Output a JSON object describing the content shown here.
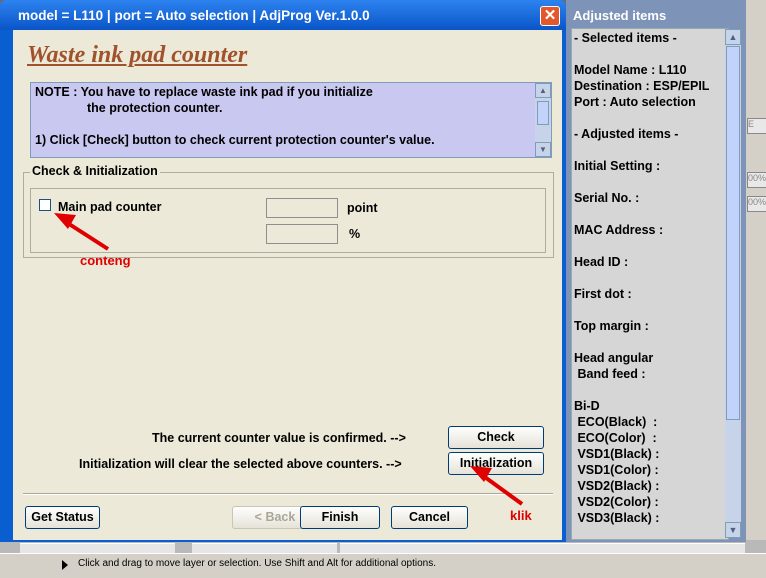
{
  "window": {
    "title": "model = L110  |  port = Auto selection  |  AdjProg Ver.1.0.0",
    "close_glyph": "✕"
  },
  "heading": "Waste ink pad counter",
  "note": {
    "line1": "NOTE : You have to replace waste ink pad if you initialize",
    "line2": "the protection counter.",
    "line3": "1) Click [Check] button to check current protection counter's value."
  },
  "check_group": {
    "label": "Check & Initialization",
    "main_pad_label": "Main pad counter",
    "main_pad_checked": false,
    "point_value": "",
    "point_unit": "point",
    "percent_value": "",
    "percent_unit": "%"
  },
  "annotations": {
    "conteng": "conteng",
    "klik": "klik",
    "color": "#e00000"
  },
  "actions": {
    "confirm_text": "The current counter value is confirmed. -->",
    "check_label": "Check",
    "init_text": "Initialization will clear the selected above counters. -->",
    "init_label": "Initialization"
  },
  "footer": {
    "get_status": "Get Status",
    "back": "< Back",
    "finish": "Finish",
    "cancel": "Cancel"
  },
  "adjusted_panel": {
    "title": "Adjusted items",
    "lines": [
      "- Selected items -",
      "Model Name : L110",
      "Destination : ESP/EPIL",
      "Port : Auto selection",
      "- Adjusted items -",
      "Initial Setting :",
      "Serial No. :",
      "MAC Address :",
      "Head ID :",
      "First dot :",
      "Top margin :",
      "Head angular",
      " Band feed :",
      "Bi-D",
      " ECO(Black)  :",
      " ECO(Color)  :",
      " VSD1(Black) :",
      " VSD1(Color) :",
      " VSD2(Black) :",
      " VSD2(Color) :",
      " VSD3(Black) :"
    ]
  },
  "background": {
    "status_text": "Click and drag to move layer or selection.  Use Shift and Alt for additional options.",
    "zoom_a": "00%",
    "zoom_b": "00%"
  },
  "colors": {
    "titlebar": "#0a5fd0",
    "panel_bg": "#7d93b8",
    "note_bg": "#c8c8f0",
    "heading": "#a0522d"
  },
  "icons": {
    "close": "close-icon",
    "arrow": "red-arrow-icon",
    "scroll_up": "chevron-up-icon",
    "scroll_down": "chevron-down-icon"
  }
}
